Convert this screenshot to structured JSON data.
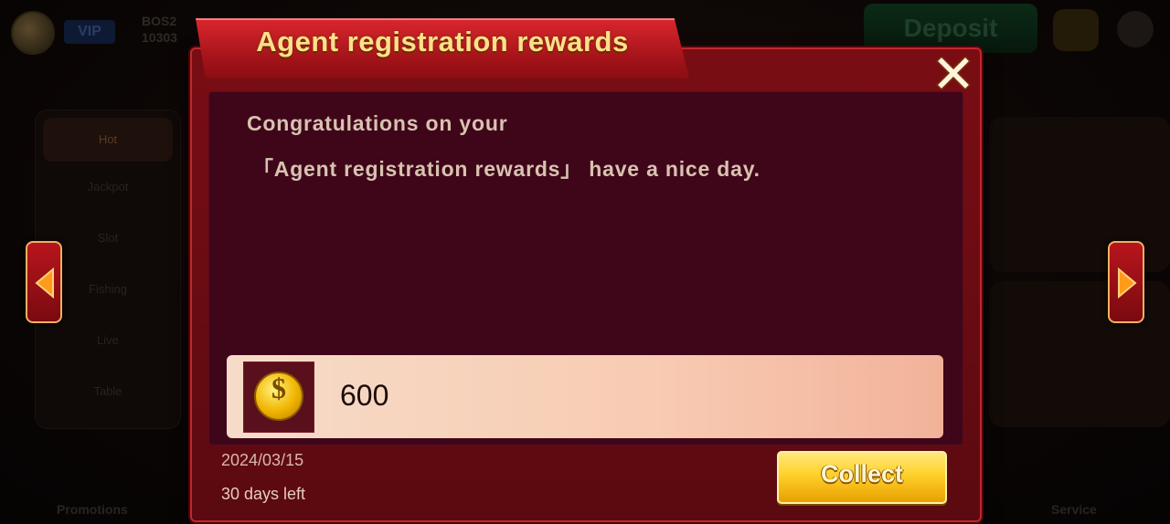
{
  "background": {
    "vip_label": "VIP",
    "user_id_line1": "BOS2",
    "user_id_line2": "10303",
    "deposit_label": "Deposit",
    "side_menu": [
      "Hot",
      "Jackpot",
      "Slot",
      "Fishing",
      "Live",
      "Table"
    ],
    "bottom": {
      "promotions_label": "Promotions",
      "service_label": "Service"
    }
  },
  "dialog": {
    "title": "Agent registration rewards",
    "close_icon": "close-icon",
    "message_line1": "Congratulations on your",
    "message_line2": "「Agent registration rewards」 have a nice day.",
    "reward": {
      "icon": "coin-icon",
      "icon_symbol": "$",
      "amount": "600"
    },
    "date": "2024/03/15",
    "days_left": "30 days left",
    "collect_label": "Collect"
  },
  "nav": {
    "prev_icon": "arrow-left-icon",
    "next_icon": "arrow-right-icon"
  },
  "colors": {
    "dialog_bg": "#5a0a10",
    "title_text": "#ffe08a",
    "content_bg": "#3f061a",
    "collect_button": "#ffd02a"
  }
}
